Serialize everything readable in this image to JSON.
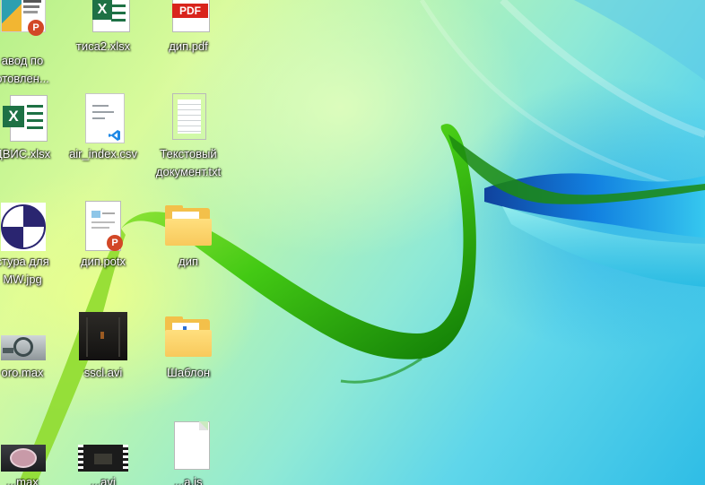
{
  "desktop": {
    "icons": [
      {
        "name": "zavod-pptx",
        "label": "авод по\nотовлен..."
      },
      {
        "name": "tisa2-xlsx",
        "label": "тиса2.xlsx"
      },
      {
        "name": "dip-pdf",
        "label": "дип.pdf",
        "badge": "PDF"
      },
      {
        "name": "dvis-xlsx",
        "label": "ДВИС.xlsx"
      },
      {
        "name": "air-index-csv",
        "label": "air_index.csv"
      },
      {
        "name": "text-doc-txt",
        "label": "Текстовый\nдокумент.txt"
      },
      {
        "name": "structure-jpg",
        "label": "стура для\nMW.jpg"
      },
      {
        "name": "dip-potx",
        "label": "дип.potx"
      },
      {
        "name": "dip-folder",
        "label": "дип"
      },
      {
        "name": "oro-max",
        "label": "oro.max"
      },
      {
        "name": "sscl-avi",
        "label": "sscl.avi"
      },
      {
        "name": "template-folder",
        "label": "Шаблон"
      },
      {
        "name": "bottom-max",
        "label": "...max"
      },
      {
        "name": "bottom-avi",
        "label": "...avi"
      },
      {
        "name": "bottom-file",
        "label": "...a.js"
      }
    ],
    "excel_letter": "X",
    "powerpoint_letter": "P",
    "colors": {
      "excel": "#1e7145",
      "powerpoint": "#d24726",
      "pdf": "#d9241c",
      "folder": "#f8c95b",
      "vscode": "#1e88e5"
    }
  }
}
